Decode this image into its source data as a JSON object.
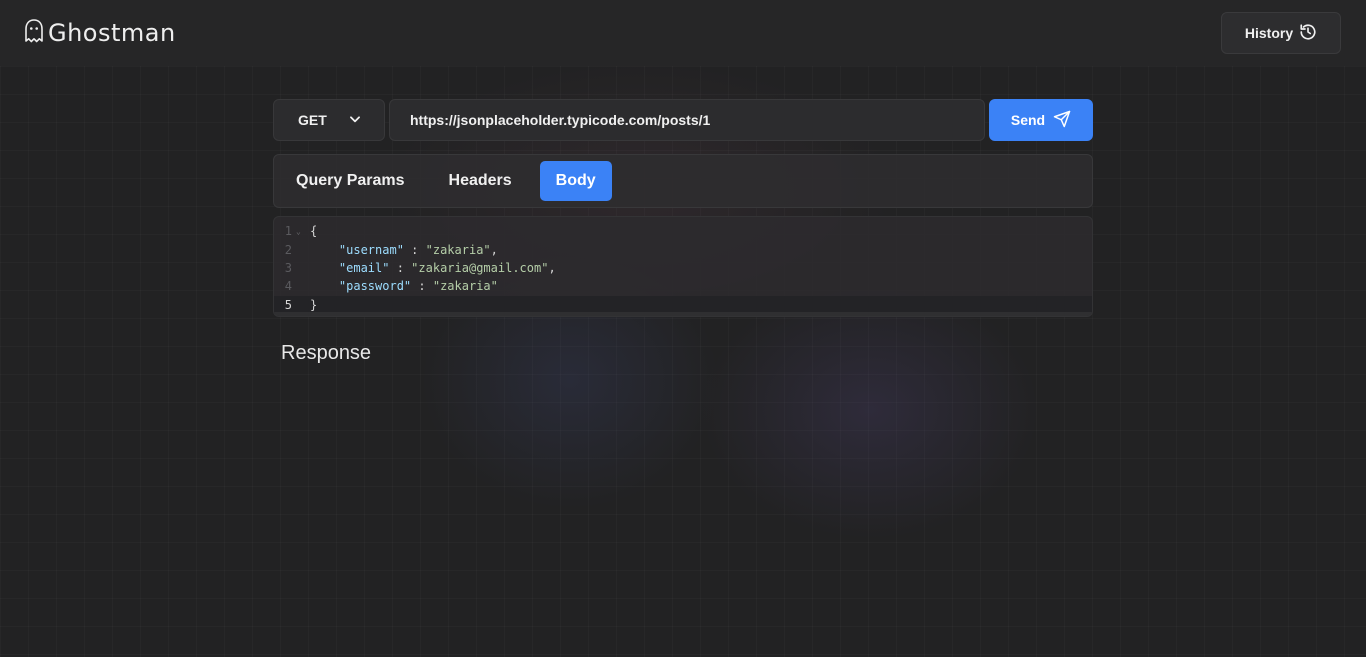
{
  "app": {
    "name": "Ghostman"
  },
  "header": {
    "history_label": "History"
  },
  "request": {
    "method": "GET",
    "url": "https://jsonplaceholder.typicode.com/posts/1",
    "send_label": "Send"
  },
  "tabs": [
    {
      "label": "Query Params",
      "active": false
    },
    {
      "label": "Headers",
      "active": false
    },
    {
      "label": "Body",
      "active": true
    }
  ],
  "editor": {
    "lines": [
      {
        "num": "1",
        "text": "{"
      },
      {
        "num": "2",
        "key": "\"usernam\"",
        "sep": " : ",
        "value": "\"zakaria\"",
        "tail": ","
      },
      {
        "num": "3",
        "key": "\"email\"",
        "sep": " : ",
        "value": "\"zakaria@gmail.com\"",
        "tail": ","
      },
      {
        "num": "4",
        "key": "\"password\"",
        "sep": " : ",
        "value": "\"zakaria\"",
        "tail": ""
      },
      {
        "num": "5",
        "text": "}"
      }
    ],
    "current_line": 5
  },
  "response": {
    "title": "Response"
  },
  "colors": {
    "accent": "#3b82f6",
    "background": "#222223"
  },
  "icons": {
    "brand": "ghost-icon",
    "history": "history-clock-icon",
    "method_dropdown": "chevron-down-icon",
    "send": "paper-plane-icon"
  }
}
